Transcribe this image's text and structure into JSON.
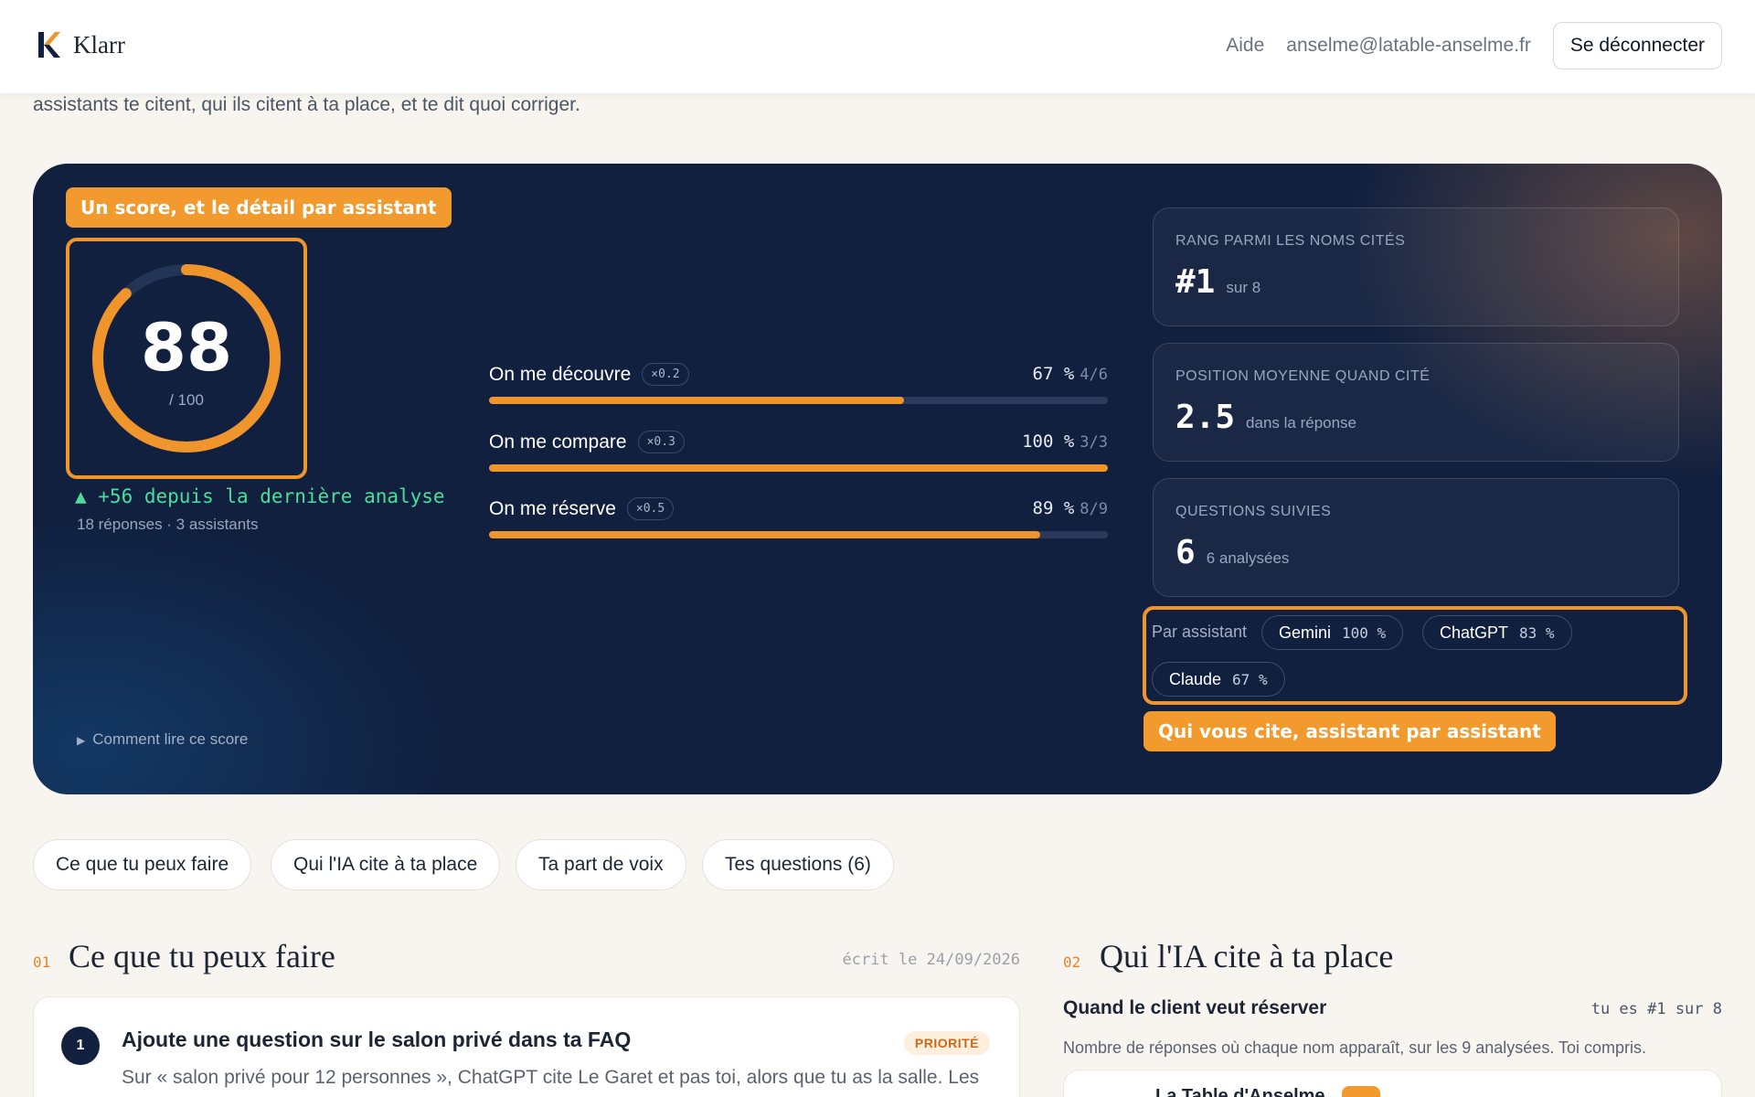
{
  "header": {
    "brand": "Klarr",
    "help_link": "Aide",
    "user_email": "anselme@latable-anselme.fr",
    "logout_label": "Se déconnecter"
  },
  "intro_text": "assistants te citent, qui ils citent à ta place, et te dit quoi corriger.",
  "hero": {
    "score_tag": "Un score, et le détail par assistant",
    "score": 88,
    "score_display": "88",
    "score_max_label": "/ 100",
    "delta_text": "▲ +56 depuis la dernière analyse",
    "meta_text": "18 réponses · 3 assistants",
    "how_to_read": "Comment lire ce score",
    "metrics": [
      {
        "label": "On me découvre",
        "weight": "×0.2",
        "percent_label": "67 %",
        "fraction": "4/6",
        "percent": 67
      },
      {
        "label": "On me compare",
        "weight": "×0.3",
        "percent_label": "100 %",
        "fraction": "3/3",
        "percent": 100
      },
      {
        "label": "On me réserve",
        "weight": "×0.5",
        "percent_label": "89 %",
        "fraction": "8/9",
        "percent": 89
      }
    ],
    "stats": [
      {
        "title": "RANG PARMI LES NOMS CITÉS",
        "value": "#1",
        "suffix": "sur 8"
      },
      {
        "title": "POSITION MOYENNE QUAND CITÉ",
        "value": "2.5",
        "suffix": "dans la réponse"
      },
      {
        "title": "QUESTIONS SUIVIES",
        "value": "6",
        "suffix": "6 analysées"
      }
    ],
    "assistants_label": "Par assistant",
    "assistants": [
      {
        "name": "Gemini",
        "pct": "100 %"
      },
      {
        "name": "ChatGPT",
        "pct": "83 %"
      },
      {
        "name": "Claude",
        "pct": "67 %"
      }
    ],
    "assistants_tag": "Qui vous cite, assistant par assistant"
  },
  "tabs": [
    "Ce que tu peux faire",
    "Qui l'IA cite à ta place",
    "Ta part de voix",
    "Tes questions (6)"
  ],
  "section1": {
    "num": "01",
    "title": "Ce que tu peux faire",
    "date": "écrit le 24/09/2026",
    "step": "1",
    "card_title": "Ajoute une question sur le salon privé dans ta FAQ",
    "priority": "PRIORITÉ",
    "card_text": "Sur « salon privé pour 12 personnes », ChatGPT cite Le Garet et pas toi, alors que tu as la salle. Les"
  },
  "section2": {
    "num": "02",
    "title": "Qui l'IA cite à ta place",
    "subtitle": "Quand le client veut réserver",
    "rank": "tu es #1 sur 8",
    "desc": "Nombre de réponses où chaque nom apparaît, sur les 9 analysées. Toi compris.",
    "first_name": "La Table d'Anselme"
  },
  "colors": {
    "accent": "#f0952c",
    "navy": "#11203f",
    "positive": "#4ade9a"
  }
}
